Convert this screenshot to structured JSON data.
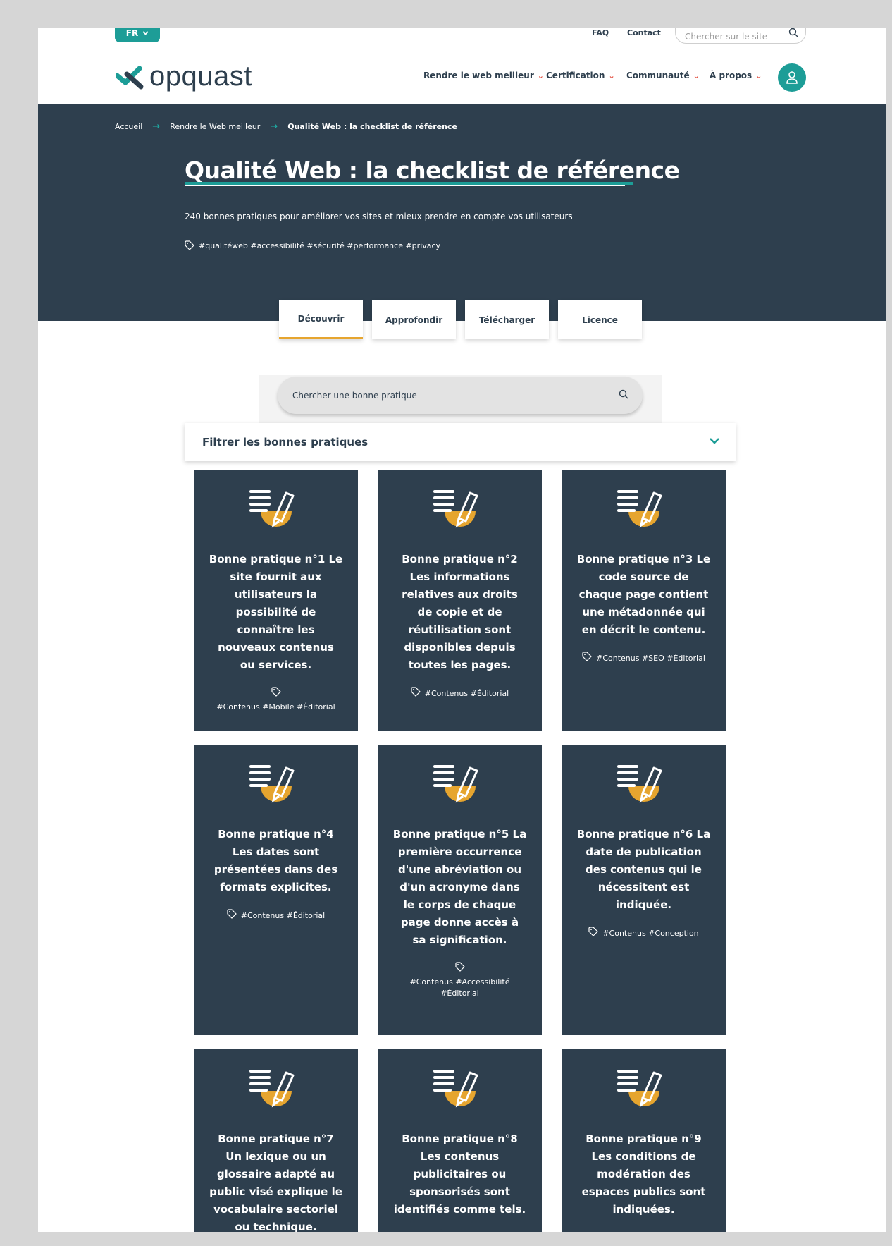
{
  "topbar": {
    "lang": "FR",
    "faq": "FAQ",
    "contact": "Contact",
    "site_search_placeholder": "Chercher sur le site"
  },
  "header": {
    "logo": "opquast",
    "nav": [
      {
        "label": "Rendre le web meilleur"
      },
      {
        "label": "Certification"
      },
      {
        "label": "Communauté"
      },
      {
        "label": "À propos"
      }
    ]
  },
  "breadcrumb": [
    "Accueil",
    "Rendre le Web meilleur",
    "Qualité Web : la checklist de référence"
  ],
  "hero": {
    "title": "Qualité Web : la checklist de référence",
    "subtitle": "240 bonnes pratiques pour améliorer vos sites et mieux prendre en compte vos utilisateurs",
    "tags": "#qualitéweb #accessibilité #sécurité #performance #privacy"
  },
  "tabs": [
    {
      "label": "Découvrir",
      "active": true
    },
    {
      "label": "Approfondir",
      "active": false
    },
    {
      "label": "Télécharger",
      "active": false
    },
    {
      "label": "Licence",
      "active": false
    }
  ],
  "practice_search": {
    "placeholder": "Chercher une bonne pratique"
  },
  "filter": {
    "label": "Filtrer les bonnes pratiques"
  },
  "cards": [
    {
      "title": "Bonne pratique n°1 Le site fournit aux utilisateurs la possibilité de connaître les nouveaux contenus ou services.",
      "tags": "#Contenus #Mobile #Éditorial"
    },
    {
      "title": "Bonne pratique n°2 Les informations relatives aux droits de copie et de réutilisation sont disponibles depuis toutes les pages.",
      "tags": "#Contenus #Éditorial"
    },
    {
      "title": "Bonne pratique n°3 Le code source de chaque page contient une métadonnée qui en décrit le contenu.",
      "tags": "#Contenus #SEO #Éditorial"
    },
    {
      "title": "Bonne pratique n°4 Les dates sont présentées dans des formats explicites.",
      "tags": "#Contenus #Éditorial"
    },
    {
      "title": "Bonne pratique n°5 La première occurrence d'une abréviation ou d'un acronyme dans le corps de chaque page donne accès à sa signification.",
      "tags": "#Contenus #Accessibilité #Éditorial"
    },
    {
      "title": "Bonne pratique n°6 La date de publication des contenus qui le nécessitent est indiquée.",
      "tags": "#Contenus #Conception"
    },
    {
      "title": "Bonne pratique n°7 Un lexique ou un glossaire adapté au public visé explique le vocabulaire sectoriel ou technique.",
      "tags": ""
    },
    {
      "title": "Bonne pratique n°8 Les contenus publicitaires ou sponsorisés sont identifiés comme tels.",
      "tags": ""
    },
    {
      "title": "Bonne pratique n°9 Les conditions de modération des espaces publics sont indiquées.",
      "tags": ""
    }
  ],
  "colors": {
    "navy": "#2e3f4e",
    "teal": "#1d9d97",
    "accent": "#e6a52f",
    "red": "#e24b3b"
  }
}
